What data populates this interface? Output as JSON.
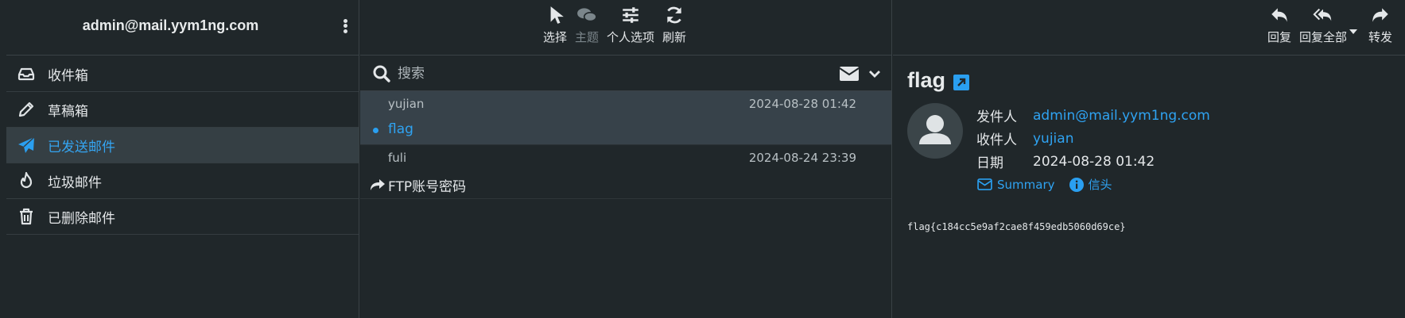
{
  "account": {
    "email": "admin@mail.yym1ng.com"
  },
  "folders": [
    {
      "label": "收件箱",
      "icon": "inbox-icon",
      "active": false
    },
    {
      "label": "草稿箱",
      "icon": "pencil-icon",
      "active": false
    },
    {
      "label": "已发送邮件",
      "icon": "paper-plane-icon",
      "active": true
    },
    {
      "label": "垃圾邮件",
      "icon": "fire-icon",
      "active": false
    },
    {
      "label": "已删除邮件",
      "icon": "trash-icon",
      "active": false
    }
  ],
  "list_toolbar": {
    "select": "选择",
    "threads": "主题",
    "options": "个人选项",
    "refresh": "刷新"
  },
  "search": {
    "placeholder": "搜索"
  },
  "messages": [
    {
      "from": "yujian",
      "date": "2024-08-28 01:42",
      "subject": "flag",
      "selected": true,
      "unread": true
    },
    {
      "from": "fuli",
      "date": "2024-08-24 23:39",
      "subject": "FTP账号密码",
      "forwarded": true
    }
  ],
  "message_toolbar": {
    "reply": "回复",
    "reply_all": "回复全部",
    "forward": "转发"
  },
  "message": {
    "subject": "flag",
    "from_label": "发件人",
    "from": "admin@mail.yym1ng.com",
    "to_label": "收件人",
    "to": "yujian",
    "date_label": "日期",
    "date": "2024-08-28 01:42",
    "summary_label": "Summary",
    "headers_label": "信头",
    "body": "flag{c184cc5e9af2cae8f459edb5060d69ce}"
  },
  "colors": {
    "accent": "#2fa3f2",
    "background": "#20272a",
    "selected_row": "#37424a"
  }
}
